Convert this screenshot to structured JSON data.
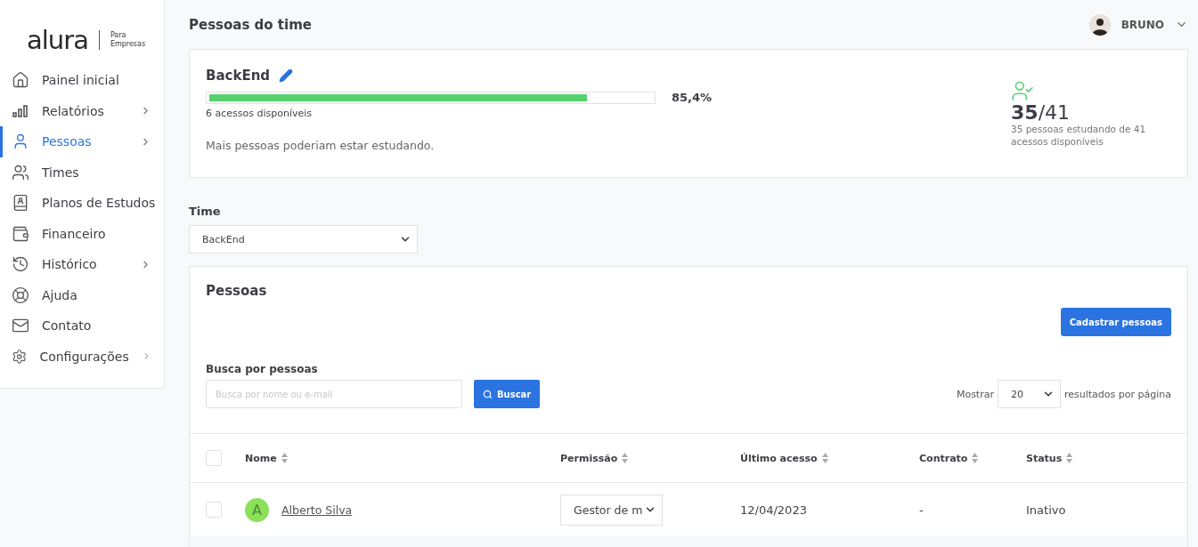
{
  "logo": {
    "brand": "alura",
    "tagline_1": "Para",
    "tagline_2": "Empresas"
  },
  "sidebar": {
    "items": [
      {
        "label": "Painel inicial",
        "kind": "home",
        "selected": false,
        "has_submenu": false
      },
      {
        "label": "Relatórios",
        "kind": "chart",
        "selected": false,
        "has_submenu": true
      },
      {
        "label": "Pessoas",
        "kind": "person",
        "selected": true,
        "has_submenu": true
      },
      {
        "label": "Times",
        "kind": "team",
        "selected": false,
        "has_submenu": false
      },
      {
        "label": "Planos de Estudos",
        "kind": "plan",
        "selected": false,
        "has_submenu": false
      },
      {
        "label": "Financeiro",
        "kind": "wallet",
        "selected": false,
        "has_submenu": false
      },
      {
        "label": "Histórico",
        "kind": "history",
        "selected": false,
        "has_submenu": true
      },
      {
        "label": "Ajuda",
        "kind": "help",
        "selected": false,
        "has_submenu": false
      },
      {
        "label": "Contato",
        "kind": "mail",
        "selected": false,
        "has_submenu": false
      },
      {
        "label": "Configurações",
        "kind": "settings",
        "selected": false,
        "has_submenu": true
      }
    ]
  },
  "page_title": "Pessoas do time",
  "user": {
    "name": "BRUNO"
  },
  "team_card": {
    "name": "BackEnd",
    "level": 0.854,
    "percent": "85,4%",
    "available": "6 acessos disponíveis",
    "message": "Mais pessoas poderiam estar estudando.",
    "count_used": "35",
    "count_total": "/41",
    "count_caption": "35 pessoas estudando de 41 acessos disponíveis"
  },
  "team_filter": {
    "label": "Time",
    "value": "BackEnd"
  },
  "people": {
    "title": "Pessoas",
    "add_button": "Cadastrar pessoas",
    "search_label": "Busca por pessoas",
    "search_placeholder": "Busca por nome ou e-mail",
    "search_button": "Buscar",
    "show_label": "Mostrar",
    "page_size": "20",
    "per_page_label": "resultados por página",
    "all_checked": false,
    "columns": [
      "Nome",
      "Permissão",
      "Último acesso",
      "Contrato",
      "Status"
    ],
    "rows": [
      {
        "checked": false,
        "initial": "A",
        "name": "Alberto Silva",
        "permission": "Gestor de m",
        "last_access": "12/04/2023",
        "contract": "-",
        "status": "Inativo"
      }
    ]
  }
}
